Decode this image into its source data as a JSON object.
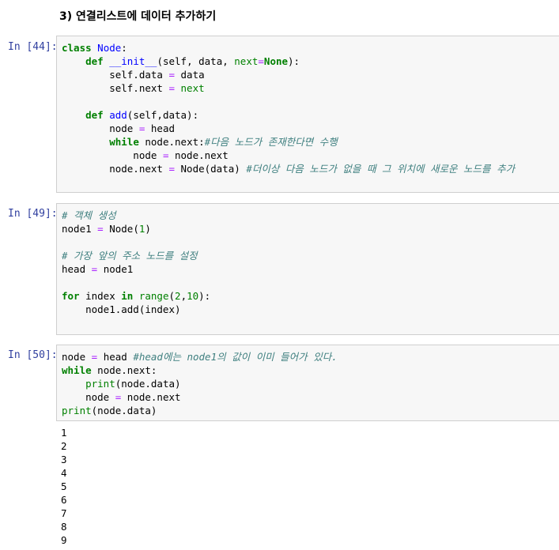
{
  "heading": "3) 연결리스트에 데이터 추가하기",
  "cells": [
    {
      "prompt": "In [44]:",
      "lines": [
        [
          [
            "kw",
            "class"
          ],
          [
            "t",
            " "
          ],
          [
            "fn",
            "Node"
          ],
          [
            "t",
            ":"
          ]
        ],
        [
          [
            "t",
            "    "
          ],
          [
            "kw",
            "def"
          ],
          [
            "t",
            " "
          ],
          [
            "fn",
            "__init__"
          ],
          [
            "t",
            "(self, data, "
          ],
          [
            "bi",
            "next"
          ],
          [
            "op",
            "="
          ],
          [
            "kw",
            "None"
          ],
          [
            "t",
            "):"
          ]
        ],
        [
          [
            "t",
            "        self.data "
          ],
          [
            "op",
            "="
          ],
          [
            "t",
            " data"
          ]
        ],
        [
          [
            "t",
            "        self.next "
          ],
          [
            "op",
            "="
          ],
          [
            "t",
            " "
          ],
          [
            "bi",
            "next"
          ]
        ],
        [],
        [
          [
            "t",
            "    "
          ],
          [
            "kw",
            "def"
          ],
          [
            "t",
            " "
          ],
          [
            "fn",
            "add"
          ],
          [
            "t",
            "(self,data):"
          ]
        ],
        [
          [
            "t",
            "        node "
          ],
          [
            "op",
            "="
          ],
          [
            "t",
            " head"
          ]
        ],
        [
          [
            "t",
            "        "
          ],
          [
            "kw",
            "while"
          ],
          [
            "t",
            " node.next:"
          ],
          [
            "cm",
            "#다음 노드가 존재한다면 수행"
          ]
        ],
        [
          [
            "t",
            "            node "
          ],
          [
            "op",
            "="
          ],
          [
            "t",
            " node.next"
          ]
        ],
        [
          [
            "t",
            "        node.next "
          ],
          [
            "op",
            "="
          ],
          [
            "t",
            " Node(data) "
          ],
          [
            "cm",
            "#더이상 다음 노드가 없을 때 그 위치에 새로운 노드를 추가"
          ]
        ],
        []
      ]
    },
    {
      "prompt": "In [49]:",
      "lines": [
        [
          [
            "cm",
            "# 객체 생성"
          ]
        ],
        [
          [
            "t",
            "node1 "
          ],
          [
            "op",
            "="
          ],
          [
            "t",
            " Node("
          ],
          [
            "num",
            "1"
          ],
          [
            "t",
            ")"
          ]
        ],
        [],
        [
          [
            "cm",
            "# 가장 앞의 주소 노드를 설정"
          ]
        ],
        [
          [
            "t",
            "head "
          ],
          [
            "op",
            "="
          ],
          [
            "t",
            " node1"
          ]
        ],
        [],
        [
          [
            "kw",
            "for"
          ],
          [
            "t",
            " index "
          ],
          [
            "kw",
            "in"
          ],
          [
            "t",
            " "
          ],
          [
            "bi",
            "range"
          ],
          [
            "t",
            "("
          ],
          [
            "num",
            "2"
          ],
          [
            "t",
            ","
          ],
          [
            "num",
            "10"
          ],
          [
            "t",
            "):"
          ]
        ],
        [
          [
            "t",
            "    node1.add(index)"
          ]
        ],
        []
      ]
    },
    {
      "prompt": "In [50]:",
      "lines": [
        [
          [
            "t",
            "node "
          ],
          [
            "op",
            "="
          ],
          [
            "t",
            " head "
          ],
          [
            "cm",
            "#head에는 node1의 값이 이미 들어가 있다."
          ]
        ],
        [
          [
            "kw",
            "while"
          ],
          [
            "t",
            " node.next:"
          ]
        ],
        [
          [
            "t",
            "    "
          ],
          [
            "bi",
            "print"
          ],
          [
            "t",
            "(node.data)"
          ]
        ],
        [
          [
            "t",
            "    node "
          ],
          [
            "op",
            "="
          ],
          [
            "t",
            " node.next"
          ]
        ],
        [
          [
            "bi",
            "print"
          ],
          [
            "t",
            "(node.data)"
          ]
        ]
      ]
    }
  ],
  "output": [
    "1",
    "2",
    "3",
    "4",
    "5",
    "6",
    "7",
    "8",
    "9"
  ]
}
